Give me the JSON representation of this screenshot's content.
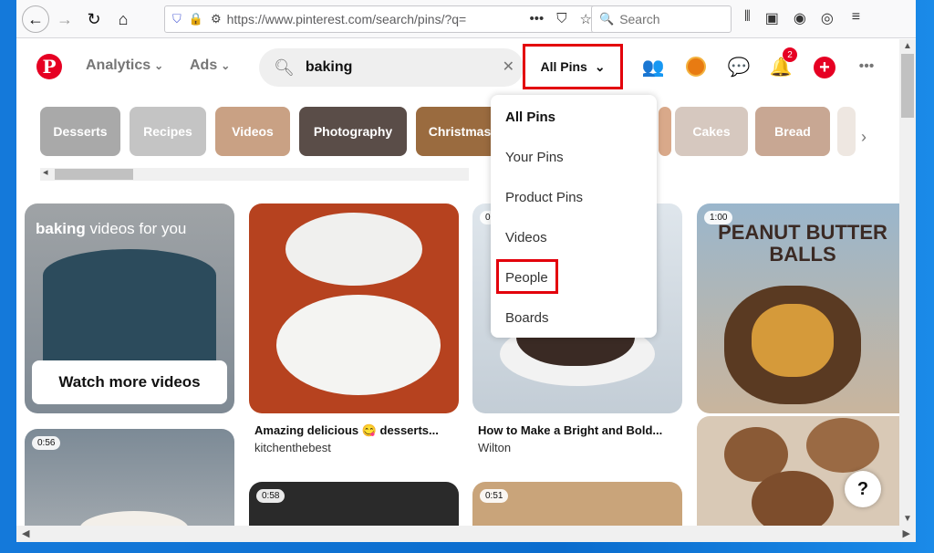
{
  "browser": {
    "url": "https://www.pinterest.com/search/pins/?q=",
    "search_placeholder": "Search"
  },
  "header": {
    "analytics_label": "Analytics",
    "ads_label": "Ads",
    "search_value": "baking",
    "filter_label": "All Pins",
    "notification_count": "2",
    "logo_letter": "P"
  },
  "chips": [
    {
      "label": "Desserts",
      "color": "#a9a9a9"
    },
    {
      "label": "Recipes",
      "color": "#c4c4c4"
    },
    {
      "label": "Videos",
      "color": "#c9a184"
    },
    {
      "label": "Photography",
      "color": "#5a4d48"
    },
    {
      "label": "Christmas",
      "color": "#9a6b3f"
    },
    {
      "label": "Cakes",
      "color": "#d6c8bf"
    },
    {
      "label": "Bread",
      "color": "#c8a793"
    }
  ],
  "dropdown": {
    "items": [
      "All Pins",
      "Your Pins",
      "Product Pins",
      "Videos",
      "People",
      "Boards"
    ]
  },
  "pins": {
    "video_card": {
      "title_bold": "baking",
      "title_rest": " videos for you",
      "button": "Watch more videos"
    },
    "pin2": {
      "caption": "Amazing delicious 😋 desserts...",
      "source": "kitchenthebest"
    },
    "pin3": {
      "caption": "How to Make a Bright and Bold...",
      "source": "Wilton",
      "time": "0"
    },
    "pin4": {
      "time": "1:00",
      "title": "PEANUT BUTTER BALLS"
    },
    "pin5": {
      "time": "0:56"
    },
    "pin6": {
      "time": "0:58"
    },
    "pin7": {
      "time": "0:51"
    }
  },
  "help_label": "?"
}
